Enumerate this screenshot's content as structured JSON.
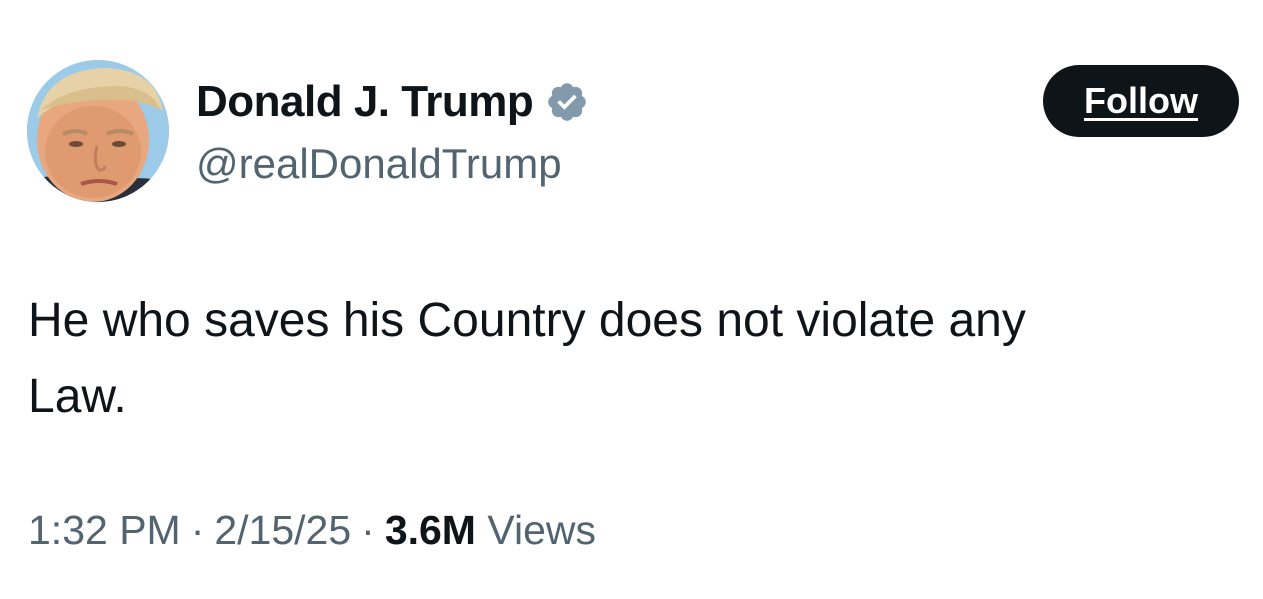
{
  "tweet": {
    "author": {
      "display_name": "Donald J. Trump",
      "handle": "@realDonaldTrump",
      "verified": true,
      "verified_badge_icon": "verified-badge-icon",
      "verified_badge_color": "#829aab"
    },
    "follow_button": {
      "label": "Follow",
      "background": "#0f1419",
      "text_color": "#ffffff"
    },
    "text_lines": [
      "He who saves his Country does not violate any",
      "Law."
    ],
    "meta": {
      "time": "1:32 PM",
      "date": "2/15/25",
      "views_count": "3.6M",
      "views_label": "Views",
      "separator": "·"
    }
  },
  "colors": {
    "text_primary": "#0f1419",
    "text_secondary": "#536471",
    "background": "#ffffff"
  }
}
